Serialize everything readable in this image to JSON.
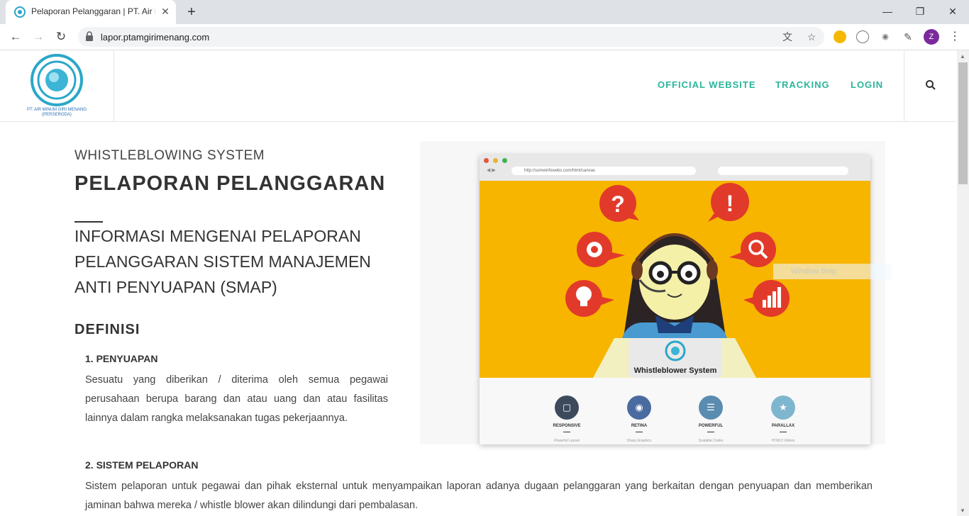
{
  "browser": {
    "tab_title": "Pelaporan Pelanggaran | PT. Air Minum Giri Menang",
    "tab_close": "✕",
    "new_tab": "+",
    "url": "lapor.ptamgirimenang.com",
    "profile_initial": "Z",
    "window_minimize": "—",
    "window_restore": "❐",
    "window_close": "✕"
  },
  "header": {
    "logo_text": "PT. AIR MINUM GIRI MENANG (PERSERODA)",
    "nav": [
      {
        "label": "OFFICIAL WEBSITE"
      },
      {
        "label": "TRACKING"
      },
      {
        "label": "LOGIN"
      }
    ]
  },
  "hero": {
    "eyebrow": "WHISTLEBLOWING SYSTEM",
    "title": "PELAPORAN PELANGGARAN",
    "subtitle": "INFORMASI MENGENAI PELAPORAN PELANGGARAN SISTEM MANAJEMEN ANTI PENYUAPAN (SMAP)"
  },
  "definisi": {
    "heading": "DEFINISI",
    "items": [
      {
        "title": "1. PENYUAPAN",
        "text": "Sesuatu yang diberikan / diterima oleh semua pegawai perusahaan berupa barang dan atau uang dan atau fasilitas lainnya dalam rangka melaksanakan tugas pekerjaannya."
      },
      {
        "title": "2. SISTEM PELAPORAN",
        "text": "Sistem pelaporan untuk pegawai dan pihak eksternal untuk menyampaikan laporan adanya dugaan pelanggaran yang berkaitan dengan penyuapan dan memberikan jaminan bahwa mereka / whistle blower akan dilindungi dari pembalasan."
      }
    ]
  },
  "illustration": {
    "inner_url": "http://someinfowebs.com/html/canvas",
    "screen_label": "Whistleblower System",
    "features": [
      {
        "label": "RESPONSIVE",
        "sub": "Powerful Layout",
        "icon": "monitor-icon",
        "color": "#3d4a5c"
      },
      {
        "label": "RETINA",
        "sub": "Sharp Graphics",
        "icon": "eye-icon",
        "color": "#4a6ba0"
      },
      {
        "label": "POWERFUL",
        "sub": "Scalable Codes",
        "icon": "layers-icon",
        "color": "#5a8cb0"
      },
      {
        "label": "PARALLAX",
        "sub": "HTML5 Videos",
        "icon": "star-icon",
        "color": "#7fb6cf"
      }
    ]
  },
  "overlay": {
    "snip_label": "Window Snip"
  },
  "colors": {
    "accent": "#2bb59a",
    "illustration_bg": "#f7b500",
    "speech_red": "#e23a2a"
  }
}
